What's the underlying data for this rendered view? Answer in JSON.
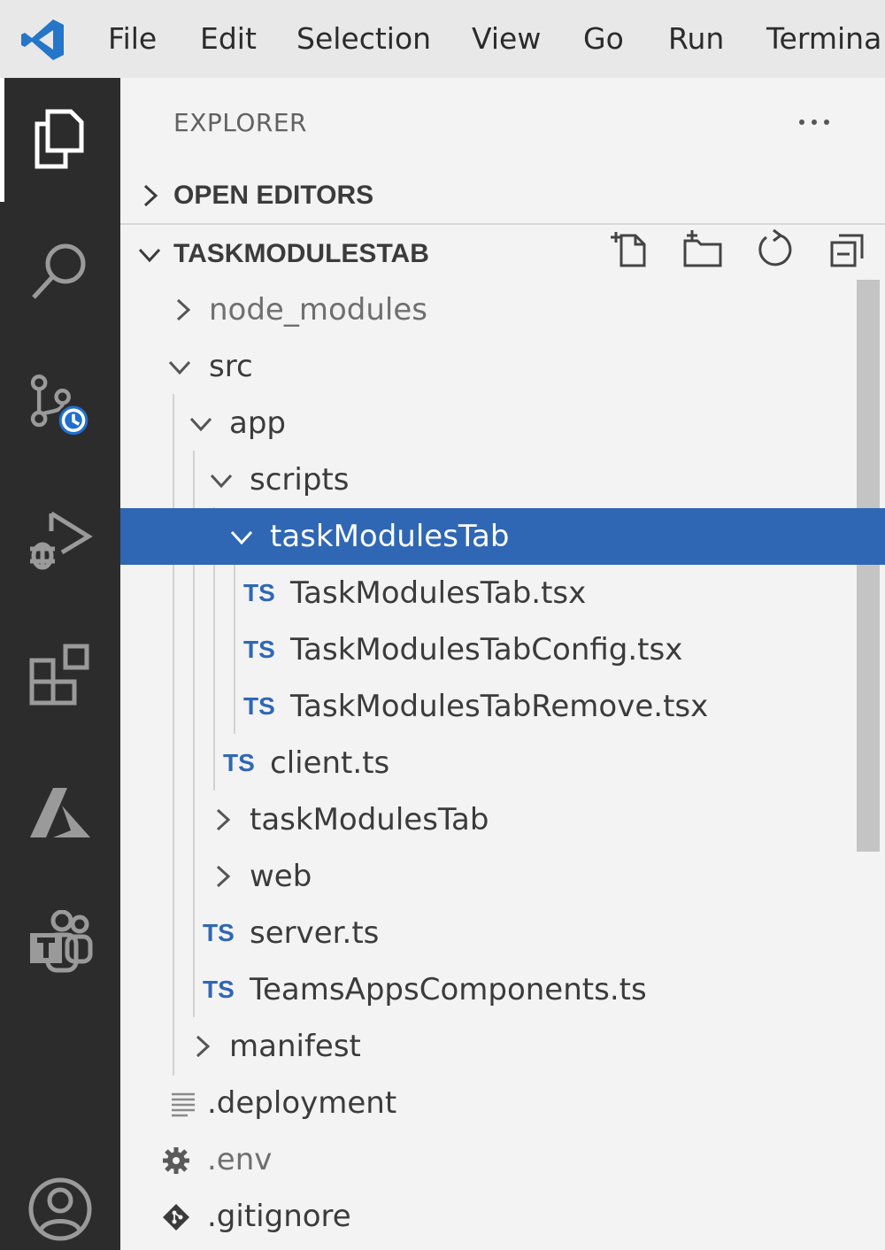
{
  "menubar": {
    "logo_icon": "vscode-logo",
    "items": [
      "File",
      "Edit",
      "Selection",
      "View",
      "Go",
      "Run",
      "Termina"
    ]
  },
  "activity_bar": {
    "icons": [
      "explorer-icon",
      "search-icon",
      "source-control-icon",
      "run-debug-icon",
      "extensions-icon",
      "azure-icon",
      "teams-toolkit-icon",
      "account-icon"
    ]
  },
  "explorer": {
    "title": "EXPLORER",
    "more_icon": "ellipsis-icon",
    "open_editors": "OPEN EDITORS",
    "workspace": "TASKMODULESTAB",
    "header_actions": [
      "new-file-icon",
      "new-folder-icon",
      "refresh-icon",
      "collapse-all-icon"
    ],
    "tree": [
      {
        "label": "node_modules",
        "type": "folder",
        "state": "collapsed"
      },
      {
        "label": "src",
        "type": "folder",
        "state": "expanded"
      },
      {
        "label": "app",
        "type": "folder",
        "state": "expanded"
      },
      {
        "label": "scripts",
        "type": "folder",
        "state": "expanded"
      },
      {
        "label": "taskModulesTab",
        "type": "folder",
        "state": "expanded",
        "selected": true
      },
      {
        "label": "TaskModulesTab.tsx",
        "type": "ts",
        "badge": "TS"
      },
      {
        "label": "TaskModulesTabConfig.tsx",
        "type": "ts",
        "badge": "TS"
      },
      {
        "label": "TaskModulesTabRemove.tsx",
        "type": "ts",
        "badge": "TS"
      },
      {
        "label": "client.ts",
        "type": "ts",
        "badge": "TS"
      },
      {
        "label": "taskModulesTab",
        "type": "folder",
        "state": "collapsed"
      },
      {
        "label": "web",
        "type": "folder",
        "state": "collapsed"
      },
      {
        "label": "server.ts",
        "type": "ts",
        "badge": "TS"
      },
      {
        "label": "TeamsAppsComponents.ts",
        "type": "ts",
        "badge": "TS"
      },
      {
        "label": "manifest",
        "type": "folder",
        "state": "collapsed"
      },
      {
        "label": ".deployment",
        "type": "file",
        "icon": "text-file-icon"
      },
      {
        "label": ".env",
        "type": "file",
        "icon": "gear-icon"
      },
      {
        "label": ".gitignore",
        "type": "file",
        "icon": "git-icon"
      }
    ]
  },
  "colors": {
    "selection": "#2f67b5",
    "ts_badge": "#2f67b5",
    "activity_bar": "#2c2c2c",
    "sidebar": "#f3f3f3",
    "badge_blue": "#1f6fd1"
  }
}
